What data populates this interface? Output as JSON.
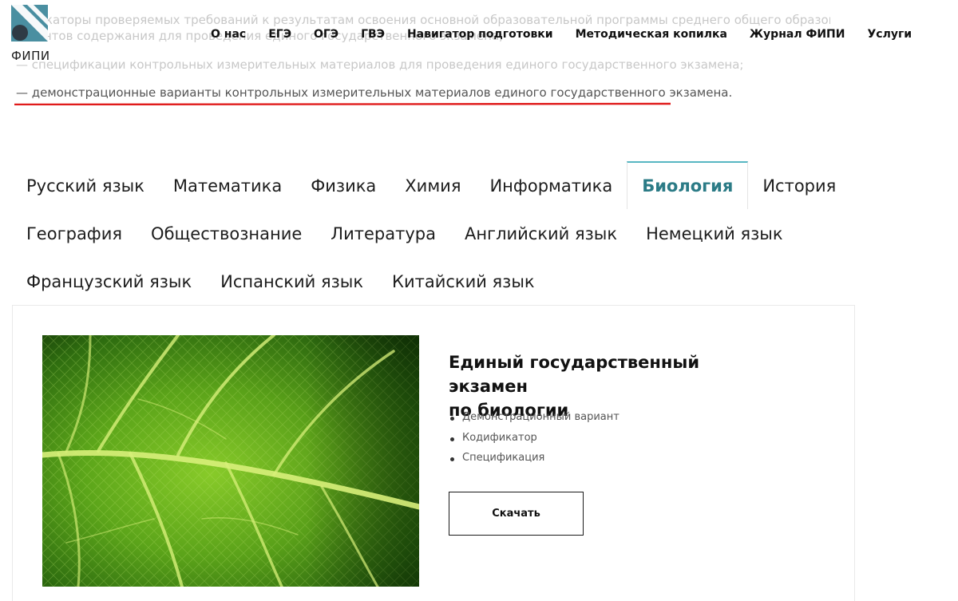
{
  "background_text": {
    "line1": "...фикаторы проверяемых требований к результатам освоения основной образовательной программы среднего общего образования",
    "line2": "...ментов содержания для проведения единого государственного экзамена;",
    "line3": "— спецификации контрольных измерительных материалов для проведения единого государственного экзамена;",
    "demo_line": "— демонстрационные варианты контрольных измерительных материалов единого государственного экзамена."
  },
  "logo": {
    "text": "ФИПИ",
    "color_primary": "#4a8fa1",
    "color_dark": "#2f3b45"
  },
  "nav": {
    "items": [
      "О нас",
      "ЕГЭ",
      "ОГЭ",
      "ГВЭ",
      "Навигатор подготовки",
      "Методическая копилка",
      "Журнал ФИПИ",
      "Услуги"
    ]
  },
  "subjects": {
    "row1": [
      "Русский язык",
      "Математика",
      "Физика",
      "Химия",
      "Информатика",
      "Биология",
      "История"
    ],
    "row2": [
      "География",
      "Обществознание",
      "Литература",
      "Английский язык",
      "Немецкий язык"
    ],
    "row3": [
      "Французский язык",
      "Испанский язык",
      "Китайский язык"
    ],
    "active": "Биология",
    "active_color": "#2b7b86"
  },
  "exam": {
    "title_line1": "Единый государственный экзамен",
    "title_line2": "по биологии",
    "documents": [
      "Демонстрационный вариант",
      "Кодификатор",
      "Спецификация"
    ],
    "download_label": "Скачать"
  },
  "annotation": {
    "underline_color": "#e01b1b"
  }
}
